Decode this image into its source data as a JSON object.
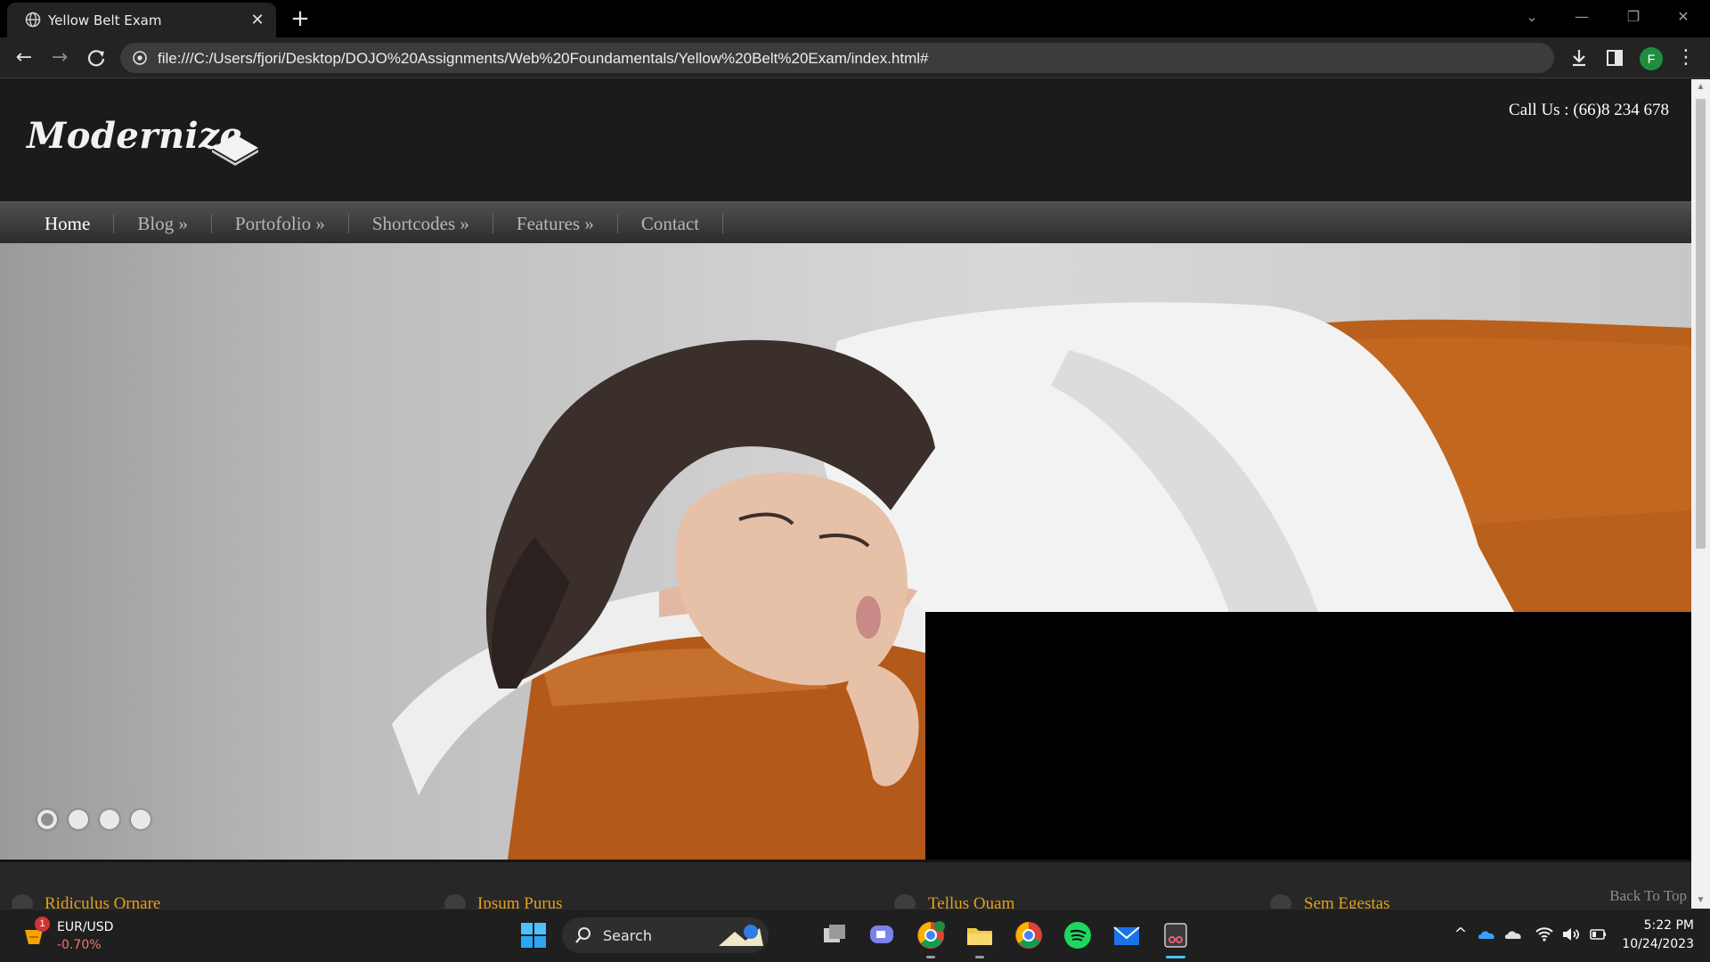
{
  "browser": {
    "tab_title": "Yellow Belt Exam",
    "tab_close": "✕",
    "new_tab": "+",
    "url": "file:///C:/Users/fjori/Desktop/DOJO%20Assignments/Web%20Foundamentals/Yellow%20Belt%20Exam/index.html#",
    "profile_initial": "F",
    "menu": "⋮",
    "window_controls": {
      "tab_search": "⌄",
      "minimize": "—",
      "restore": "❐",
      "close": "✕"
    }
  },
  "site": {
    "logo_text": "Modernize",
    "call_us": "Call Us : (66)8 234 678",
    "nav": [
      {
        "label": "Home"
      },
      {
        "label": "Blog »"
      },
      {
        "label": "Portofolio »"
      },
      {
        "label": "Shortcodes »"
      },
      {
        "label": "Features »"
      },
      {
        "label": "Contact"
      }
    ],
    "slider": {
      "dot_count": 4,
      "active_index": 0
    },
    "features": [
      {
        "title": "Ridiculus Ornare"
      },
      {
        "title": "Ipsum Purus"
      },
      {
        "title": "Tellus Quam"
      },
      {
        "title": "Sem Egestas"
      }
    ],
    "back_to_top": "Back To Top"
  },
  "taskbar": {
    "ticker": {
      "badge": "1",
      "symbol": "EUR/USD",
      "change": "-0.70%"
    },
    "search_label": "Search",
    "tray_chevron": "^",
    "clock": {
      "time": "5:22 PM",
      "date": "10/24/2023"
    }
  },
  "colors": {
    "accent": "#e2a020",
    "header_bg": "#1b1b1b",
    "taskbar_bg": "#1f1f1f",
    "ticker_negative": "#f87171"
  }
}
